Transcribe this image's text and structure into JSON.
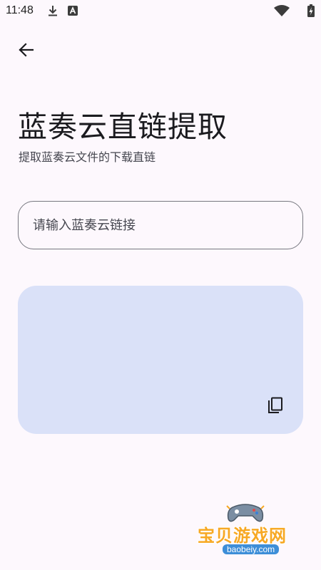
{
  "status_bar": {
    "time": "11:48",
    "icons": [
      "download-icon",
      "app-notification-icon",
      "wifi-icon",
      "battery-charging-icon"
    ]
  },
  "toolbar": {
    "back_icon": "arrow-back-icon"
  },
  "header": {
    "title": "蓝奏云直链提取",
    "subtitle": "提取蓝奏云文件的下载直链"
  },
  "link_input": {
    "value": "",
    "placeholder": "请输入蓝奏云链接"
  },
  "result_card": {
    "text": "",
    "copy_icon": "copy-icon"
  },
  "watermark": {
    "text": "宝贝游戏网",
    "url": "baobeiy.com"
  },
  "colors": {
    "background": "#fdf8fd",
    "card": "#dae1f8",
    "outline": "#76777f",
    "watermark": "#f7a823"
  }
}
